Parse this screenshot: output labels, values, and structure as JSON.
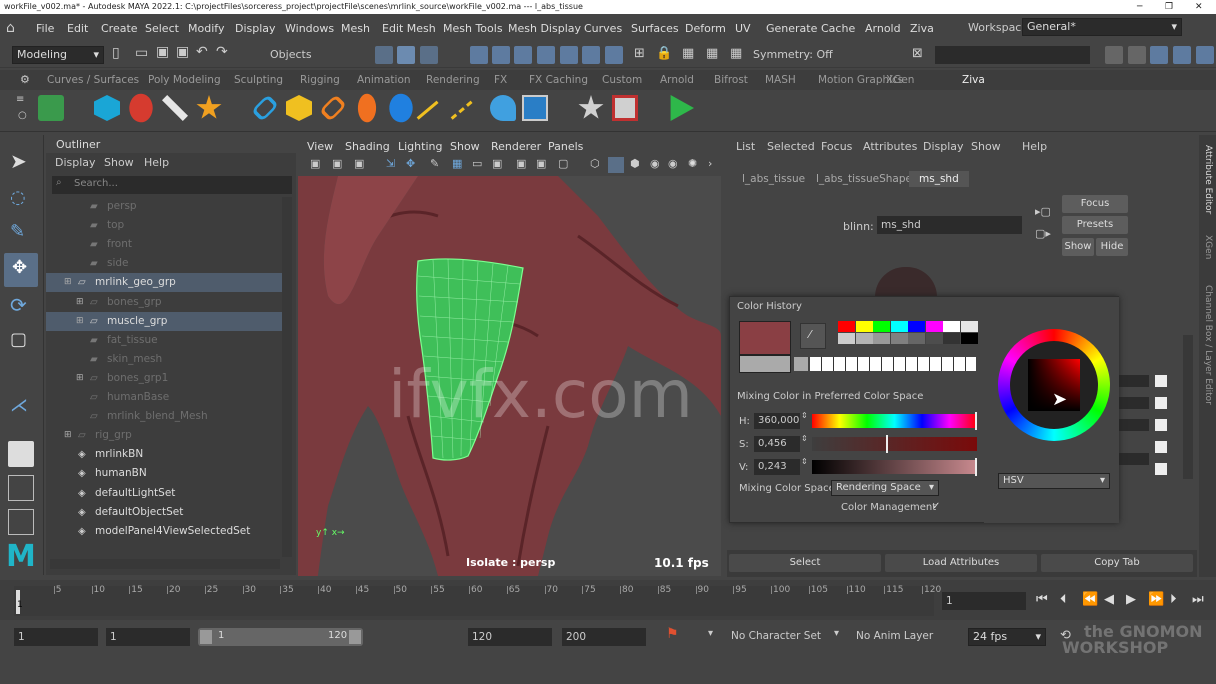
{
  "titlebar": {
    "text": "workFile_v002.ma* - Autodesk MAYA 2022.1: C:\\projectFiles\\sorceress_project\\projectFile\\scenes\\mrlink_source\\workFile_v002.ma --- l_abs_tissue"
  },
  "menus": [
    "File",
    "Edit",
    "Create",
    "Select",
    "Modify",
    "Display",
    "Windows",
    "Mesh",
    "Edit Mesh",
    "Mesh Tools",
    "Mesh Display",
    "Curves",
    "Surfaces",
    "Deform",
    "UV",
    "Generate",
    "Cache",
    "Arnold",
    "Ziva"
  ],
  "workspace": {
    "label": "Workspace:",
    "value": "General*"
  },
  "statusline": {
    "mode": "Modeling",
    "objects": "Objects",
    "symmetry": "Symmetry: Off"
  },
  "shelf_tabs": [
    "Curves / Surfaces",
    "Poly Modeling",
    "Sculpting",
    "Rigging",
    "Animation",
    "Rendering",
    "FX",
    "FX Caching",
    "Custom",
    "Arnold",
    "Bifrost",
    "MASH",
    "Motion Graphics",
    "XGen",
    "Ziva"
  ],
  "shelf_active": "Ziva",
  "outliner": {
    "title": "Outliner",
    "menus": [
      "Display",
      "Show",
      "Help"
    ],
    "search_placeholder": "Search...",
    "rows": [
      {
        "label": "persp",
        "dim": true
      },
      {
        "label": "top",
        "dim": true
      },
      {
        "label": "front",
        "dim": true
      },
      {
        "label": "side",
        "dim": true
      },
      {
        "label": "mrlink_geo_grp",
        "dim": false
      },
      {
        "label": "bones_grp",
        "dim": true
      },
      {
        "label": "muscle_grp",
        "dim": false
      },
      {
        "label": "fat_tissue",
        "dim": true
      },
      {
        "label": "skin_mesh",
        "dim": true
      },
      {
        "label": "bones_grp1",
        "dim": true
      },
      {
        "label": "humanBase",
        "dim": true
      },
      {
        "label": "mrlink_blend_Mesh",
        "dim": true
      },
      {
        "label": "rig_grp",
        "dim": true
      },
      {
        "label": "mrlinkBN",
        "dim": false
      },
      {
        "label": "humanBN",
        "dim": false
      },
      {
        "label": "defaultLightSet",
        "dim": false
      },
      {
        "label": "defaultObjectSet",
        "dim": false
      },
      {
        "label": "modelPanel4ViewSelectedSet",
        "dim": false
      }
    ]
  },
  "viewport": {
    "menus": [
      "View",
      "Shading",
      "Lighting",
      "Show",
      "Renderer",
      "Panels"
    ],
    "isolate": "Isolate : persp",
    "fps": "10.1 fps"
  },
  "attribute_editor": {
    "menus": [
      "List",
      "Selected",
      "Focus",
      "Attributes",
      "Display",
      "Show",
      "Help"
    ],
    "tabs": [
      "l_abs_tissue",
      "l_abs_tissueShape",
      "ms_shd"
    ],
    "active_tab": "ms_shd",
    "node_type": "blinn:",
    "node_name": "ms_shd",
    "buttons": {
      "focus": "Focus",
      "presets": "Presets",
      "show": "Show",
      "hide": "Hide"
    },
    "bottom": {
      "select": "Select",
      "load": "Load Attributes",
      "copy": "Copy Tab"
    },
    "side_tabs": [
      "Attribute Editor",
      "XGen",
      "Channel Box / Layer Editor"
    ]
  },
  "color_chooser": {
    "history_label": "Color History",
    "mixing_label": "Mixing Color in Preferred Color Space",
    "h_label": "H:",
    "h_value": "360,000",
    "s_label": "S:",
    "s_value": "0,456",
    "v_label": "V:",
    "v_value": "0,243",
    "hsv": {
      "h": 360.0,
      "s": 0.456,
      "v": 0.243
    },
    "space_label": "Mixing Color Space:",
    "space_value": "Rendering Space",
    "management": "Color Management",
    "mode": "HSV",
    "current_color": "#8a3f44",
    "palette": [
      "#ff0000",
      "#ffff00",
      "#00ff00",
      "#00ffff",
      "#0000ff",
      "#ff00ff",
      "#ffffff",
      "#e6e6e6",
      "#cccccc",
      "#b3b3b3",
      "#999999",
      "#808080",
      "#666666",
      "#4d4d4d",
      "#333333",
      "#000000"
    ]
  },
  "timeline": {
    "ticks": [
      "5",
      "10",
      "15",
      "20",
      "25",
      "30",
      "35",
      "40",
      "45",
      "50",
      "55",
      "60",
      "65",
      "70",
      "75",
      "80",
      "85",
      "90",
      "95",
      "100",
      "105",
      "110",
      "115",
      "120"
    ],
    "start_label": "1",
    "current_frame": "1"
  },
  "range": {
    "start": "1",
    "anim_start": "1",
    "range_start": "1",
    "range_end": "120",
    "end": "120",
    "anim_end": "200",
    "character": "No Character Set",
    "anim_layer": "No Anim Layer",
    "fps": "24 fps"
  },
  "watermark": {
    "text": "ifvfx.com",
    "brand1": "the GNOMON",
    "brand2": "WORKSHOP"
  }
}
